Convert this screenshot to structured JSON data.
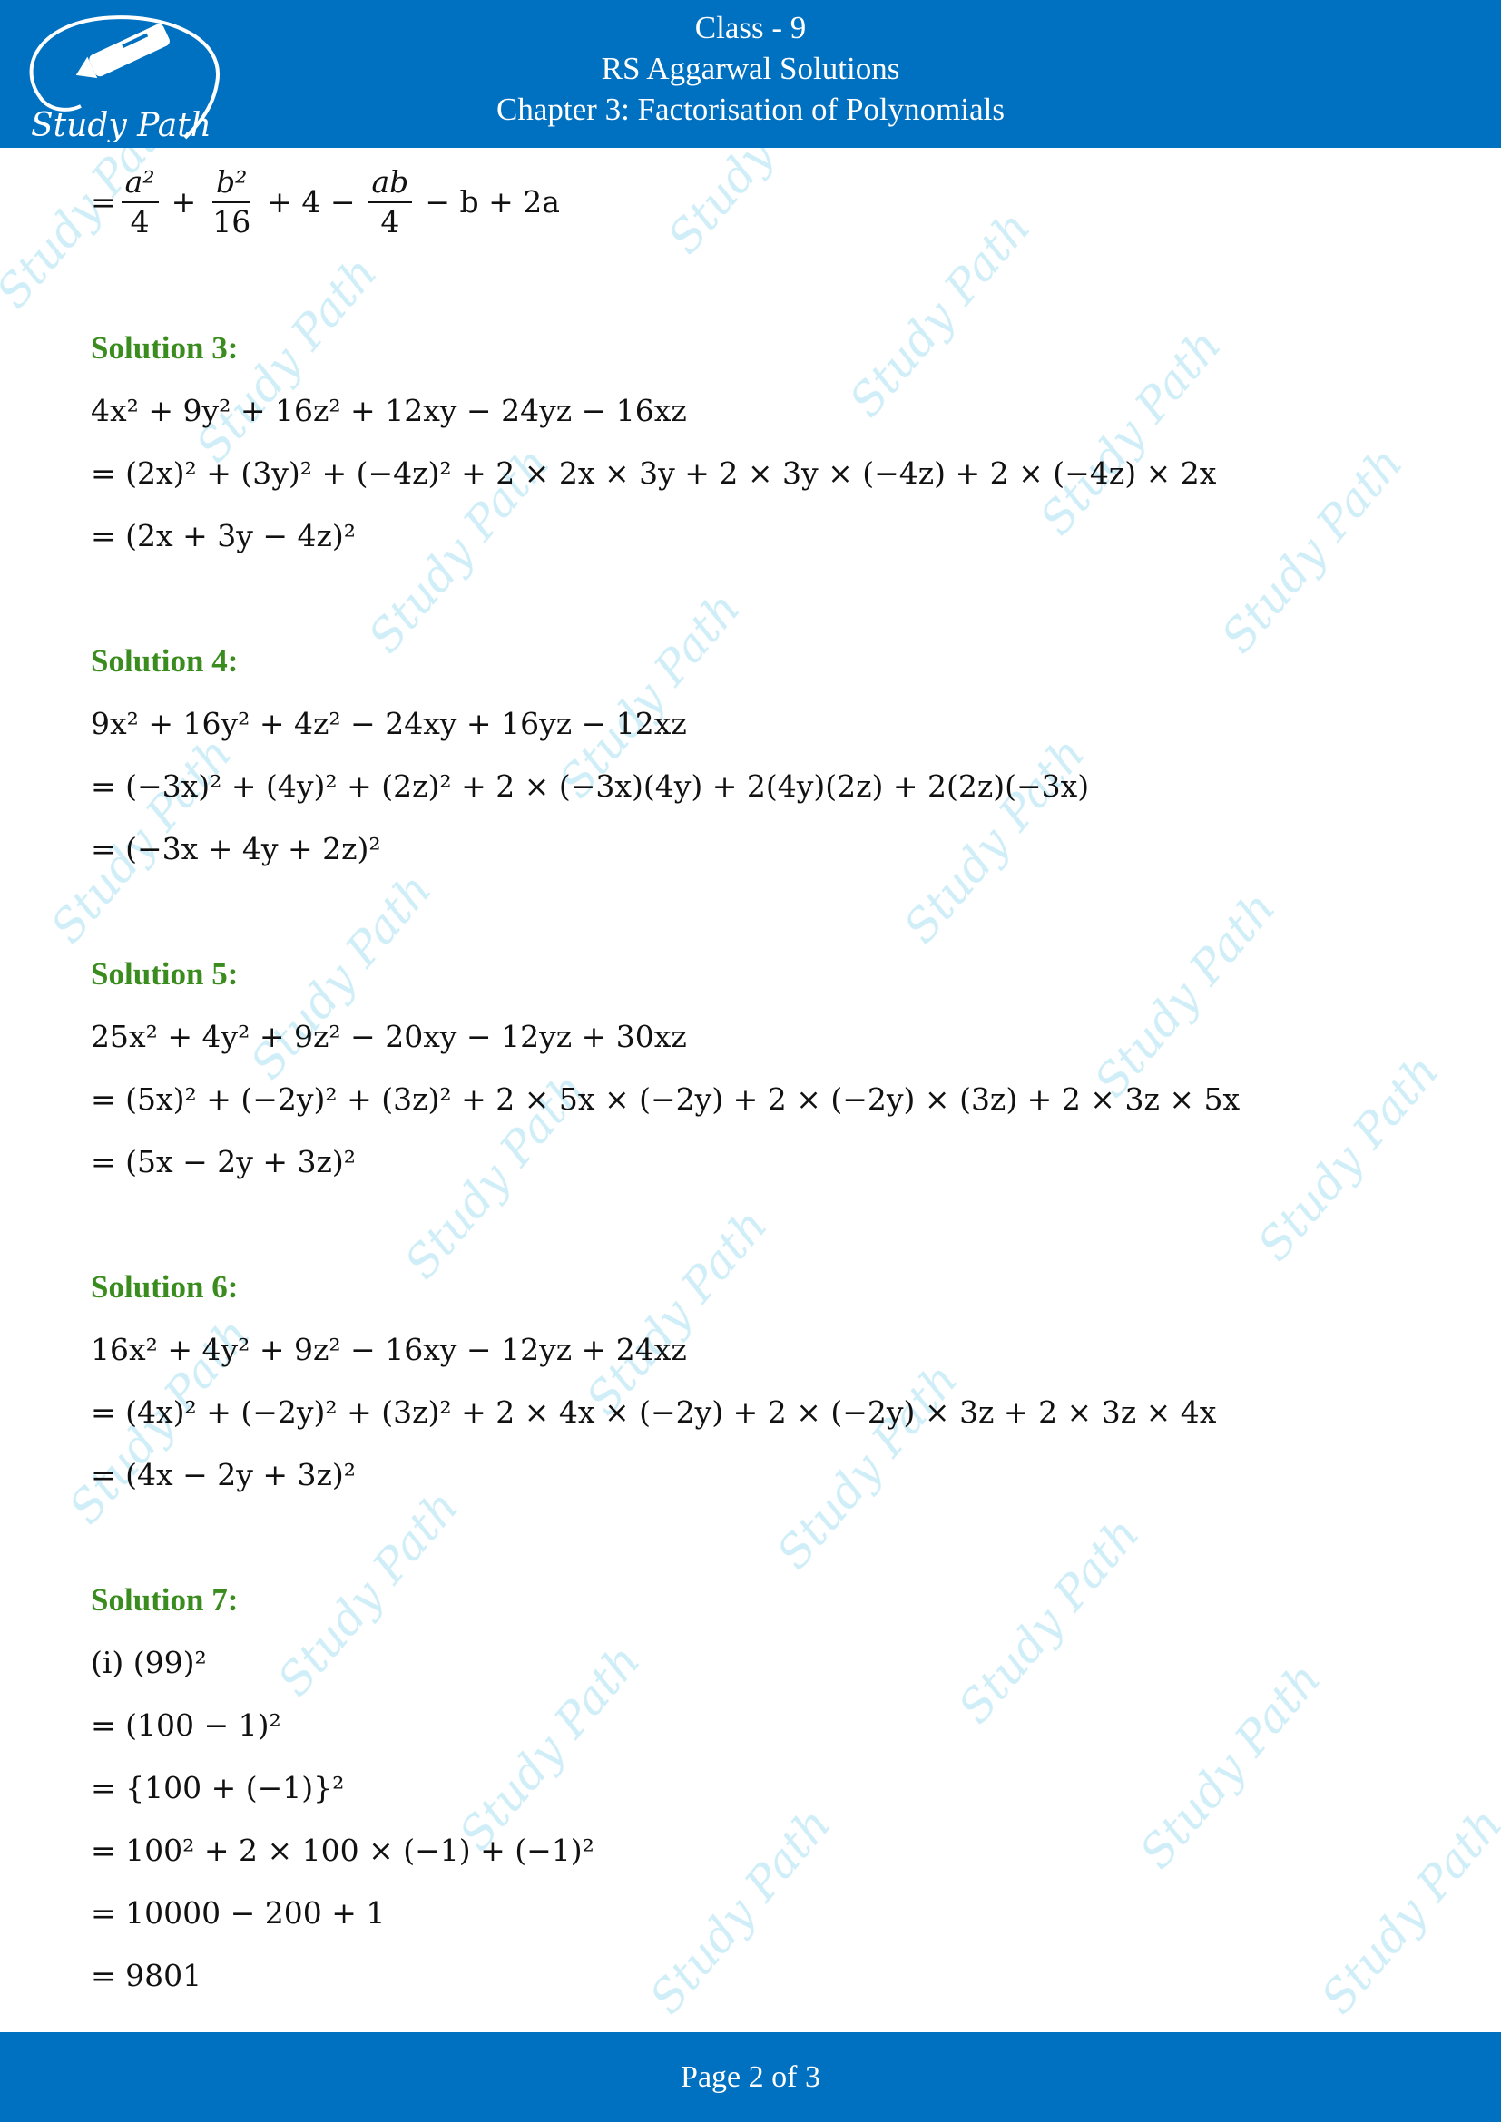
{
  "header": {
    "class_label": "Class - 9",
    "book_title": "RS Aggarwal Solutions",
    "chapter_title": "Chapter 3: Factorisation of Polynomials",
    "logo_text": "Study Path",
    "bg_color": "#0070c0"
  },
  "carryover": {
    "prefix": "=",
    "terms": [
      {
        "num": "a²",
        "den": "4",
        "op_after": "+"
      },
      {
        "num": "b²",
        "den": "16",
        "op_after": "+ 4 −"
      },
      {
        "num": "ab",
        "den": "4",
        "op_after": "− b + 2a"
      }
    ]
  },
  "solutions": [
    {
      "heading": "Solution 3:",
      "lines": [
        "4x² + 9y² + 16z² + 12xy − 24yz − 16xz",
        "= (2x)² + (3y)² + (−4z)² + 2 × 2x × 3y + 2 × 3y × (−4z) + 2 × (−4z) × 2x",
        "= (2x + 3y − 4z)²"
      ]
    },
    {
      "heading": "Solution 4:",
      "lines": [
        "9x² + 16y² + 4z² − 24xy + 16yz − 12xz",
        "= (−3x)² + (4y)² + (2z)² + 2 × (−3x)(4y) + 2(4y)(2z) + 2(2z)(−3x)",
        "= (−3x + 4y + 2z)²"
      ]
    },
    {
      "heading": "Solution 5:",
      "lines": [
        "25x² + 4y² + 9z² − 20xy − 12yz + 30xz",
        "= (5x)² + (−2y)² + (3z)² + 2 × 5x × (−2y) + 2 × (−2y) × (3z) + 2 × 3z × 5x",
        "= (5x − 2y + 3z)²"
      ]
    },
    {
      "heading": "Solution 6:",
      "lines": [
        "16x² + 4y² + 9z² − 16xy − 12yz + 24xz",
        "= (4x)² + (−2y)² + (3z)² + 2 × 4x × (−2y) + 2 × (−2y) × 3z + 2 × 3z × 4x",
        "= (4x − 2y + 3z)²"
      ]
    },
    {
      "heading": "Solution 7:",
      "lines": [
        "(i) (99)²",
        "= (100 − 1)²",
        "= {100 + (−1)}²",
        "= 100² + 2 × 100 × (−1) + (−1)²",
        "= 10000 − 200 + 1",
        "= 9801"
      ]
    }
  ],
  "footer": {
    "page_label": "Page 2 of 3"
  },
  "colors": {
    "heading_green": "#3a8c1f",
    "watermark": "#bfe8f5"
  }
}
